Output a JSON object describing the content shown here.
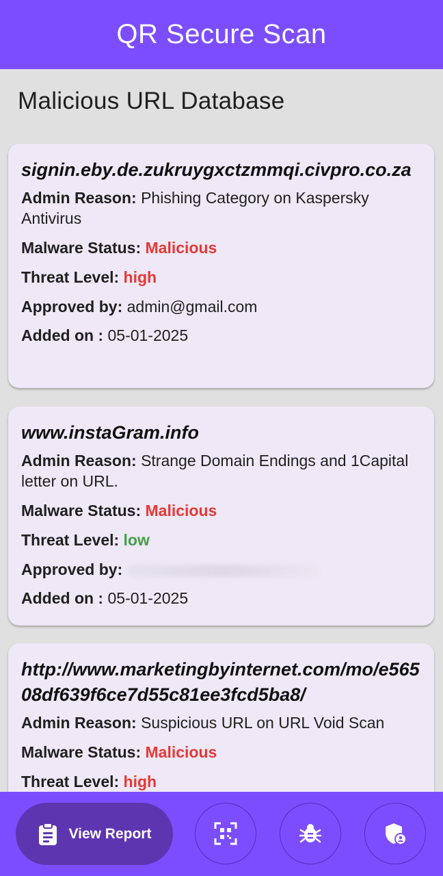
{
  "app_bar": {
    "title": "QR Secure Scan"
  },
  "page": {
    "heading": "Malicious URL Database"
  },
  "labels": {
    "admin_reason": "Admin Reason:",
    "malware_status": "Malware Status:",
    "threat_level": "Threat Level:",
    "approved_by": "Approved by:",
    "added_on": "Added on :"
  },
  "cards": [
    {
      "url": "signin.eby.de.zukruygxctzmmqi.civpro.co.za",
      "admin_reason": "Phishing Category on Kaspersky Antivirus",
      "malware_status": "Malicious",
      "threat_level": "high",
      "approved_by": "admin@gmail.com",
      "added_on": "05-01-2025"
    },
    {
      "url": "www.instaGram.info",
      "admin_reason": "Strange Domain Endings and 1Capital letter on URL.",
      "malware_status": "Malicious",
      "threat_level": "low",
      "approved_by": "",
      "added_on": "05-01-2025"
    },
    {
      "url": "http://www.marketingbyinternet.com/mo/e56508df639f6ce7d55c81ee3fcd5ba8/",
      "admin_reason": "Suspicious URL on URL Void Scan",
      "malware_status": "Malicious",
      "threat_level": "high"
    }
  ],
  "bottom_nav": {
    "view_report_label": "View Report",
    "items": [
      {
        "icon": "clipboard-icon"
      },
      {
        "icon": "qr-scan-icon"
      },
      {
        "icon": "bug-icon"
      },
      {
        "icon": "shield-user-icon"
      }
    ]
  },
  "colors": {
    "primary": "#7c4dff",
    "primary_dark": "#5e35b1",
    "card_bg": "#efe8f7",
    "threat_high": "#e53935",
    "threat_low": "#43a047"
  }
}
